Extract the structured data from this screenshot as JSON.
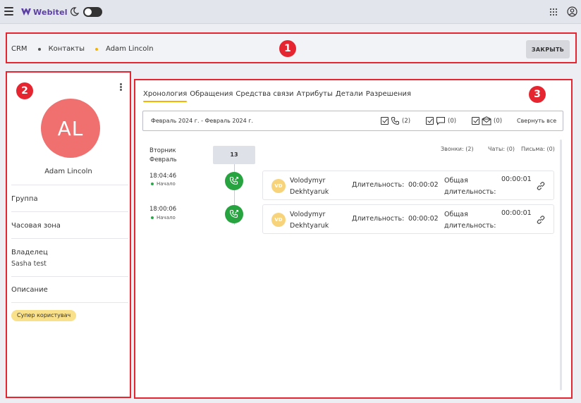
{
  "topbar": {
    "brand": "Webitel",
    "brand_color": "#5b3fa3",
    "icons": [
      "menu-icon",
      "moon-icon",
      "apps-grid-icon",
      "user-account-icon"
    ]
  },
  "badges": {
    "one": "1",
    "two": "2",
    "three": "3"
  },
  "breadcrumb": {
    "items": [
      "CRM",
      "Контакты",
      "Adam Lincoln"
    ],
    "dot_colors": [
      "#555555",
      "#f4b400"
    ]
  },
  "header": {
    "close_label": "ЗАКРЫТЬ"
  },
  "contact": {
    "initials": "AL",
    "avatar_color": "#f06f6f",
    "name": "Adam Lincoln",
    "fields": {
      "group": {
        "label": "Группа"
      },
      "timezone": {
        "label": "Часовая зона"
      },
      "owner": {
        "label": "Владелец",
        "value": "Sasha test"
      },
      "description": {
        "label": "Описание"
      }
    },
    "tag": "Супер користувач"
  },
  "tabs": [
    {
      "label": "Хронология",
      "active": true
    },
    {
      "label": "Обращения"
    },
    {
      "label": "Средства связи"
    },
    {
      "label": "Атрибуты"
    },
    {
      "label": "Детали"
    },
    {
      "label": "Разрешения"
    }
  ],
  "filters": {
    "date_range": "Февраль 2024 г. - Февраль 2024 г.",
    "calls_count": "(2)",
    "chats_count": "(0)",
    "emails_count": "(0)",
    "collapse_all": "Свернуть все"
  },
  "timeline": {
    "weekday": "Вторник",
    "month": "Февраль",
    "day": "13",
    "counters": {
      "calls": "Звонки: (2)",
      "chats": "Чаты: (0)",
      "emails": "Письма: (0)"
    },
    "events": [
      {
        "time": "18:04:46",
        "status": "Начало",
        "initials": "VD",
        "first_name": "Volodymyr",
        "last_name": "Dekhtyaruk",
        "duration_label": "Длительность:",
        "duration": "00:00:02",
        "total_label_1": "Общая",
        "total_label_2": "длительность:",
        "total": "00:00:01"
      },
      {
        "time": "18:00:06",
        "status": "Начало",
        "initials": "VD",
        "first_name": "Volodymyr",
        "last_name": "Dekhtyaruk",
        "duration_label": "Длительность:",
        "duration": "00:00:02",
        "total_label_1": "Общая",
        "total_label_2": "длительность:",
        "total": "00:00:01"
      }
    ]
  },
  "colors": {
    "highlight": "#e5252f",
    "accent": "#f4b400",
    "call_green": "#27a33f"
  }
}
